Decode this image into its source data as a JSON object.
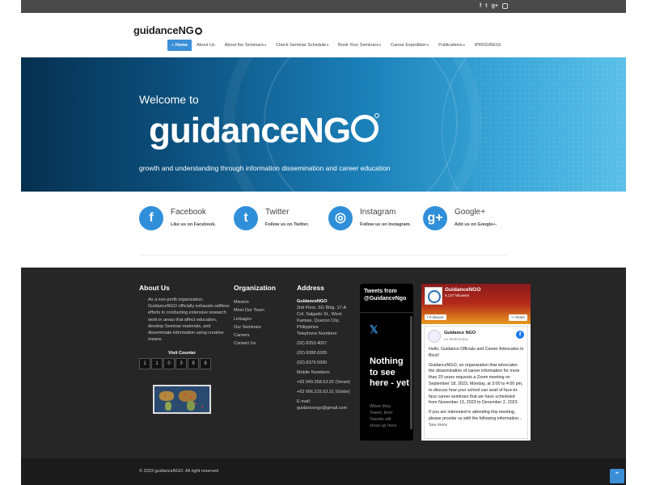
{
  "topbar": {
    "social_icons": [
      {
        "icon": "facebook-icon",
        "glyph": "f"
      },
      {
        "icon": "twitter-icon",
        "glyph": "t"
      },
      {
        "icon": "google-plus-icon",
        "glyph": "g+"
      },
      {
        "icon": "instagram-icon",
        "glyph": ""
      }
    ]
  },
  "logo": {
    "text": "guidanceNG"
  },
  "nav": {
    "home": "Home",
    "about": "About Us",
    "seminars": "About the Seminars",
    "schedule": "Check Seminar Schedule",
    "book": "Book Your Seminars",
    "expedition": "Career Expedition",
    "publications": "Publications",
    "iprogress": "IPROGRESS",
    "caret": "▾"
  },
  "hero": {
    "welcome": "Welcome to",
    "title": "guidanceNG",
    "tagline": "growth and understanding through information dissemination and career education"
  },
  "socials": {
    "facebook": {
      "glyph": "f",
      "name": "Facebook",
      "sub": "Like us on Facebook."
    },
    "twitter": {
      "glyph": "t",
      "name": "Twitter",
      "sub": "Follow us on Twitter."
    },
    "instagram": {
      "glyph": "◎",
      "name": "Instagram",
      "sub": "Follow us on Instagram."
    },
    "google": {
      "glyph": "g+",
      "name": "Google+",
      "sub": "Add us on Google+."
    }
  },
  "footer": {
    "about": {
      "heading": "About Us",
      "text": "As a non-profit organization, GuidanceNGO officially exhausts selfless efforts in conducting extensive research work in areas that affect education, develop Seminar materials, and disseminate information using creative means.",
      "visit_label": "Visit Counter",
      "counter_digits": [
        "1",
        "1",
        "0",
        "3",
        "9",
        "6"
      ]
    },
    "organization": {
      "heading": "Organization",
      "links": [
        "Mission",
        "Meet Our Team",
        "Linkages",
        "Our Seminars",
        "Careers",
        "Contact Us"
      ]
    },
    "address": {
      "heading": "Address",
      "org": "GuidanceNGO",
      "line1": "2nd Floor, SG Bldg. 17-A Col. Salgado St., West Kamias, Quezon City, Philippines",
      "tel_label": "Telephone Numbers:",
      "tel1": "(02) 8253.4057",
      "tel2": "(02) 8288.6265",
      "tel3": "(02) 8376.5990",
      "mobile_label": "Mobile Numbers:",
      "mobile1": "+63 949.358.53.92 (Smart)",
      "mobile2": "+63 906.315.63.31 (Globe)",
      "email_label": "E-mail:",
      "email": "guidancengo@gmail.com"
    },
    "twitter": {
      "heading": "Tweets from @GuidanceNgo",
      "empty_title": "Nothing to see here - yet",
      "empty_text": "When they Tweet, their Tweets will show up here."
    },
    "facebook": {
      "page_name": "GuidanceNGO",
      "followers": "6,137 followers",
      "followed": "Followed",
      "share": "Share",
      "post_author": "Guidance NGO",
      "post_when": "on Wednesday",
      "post_p1": "Hello, Guidance Officials and Career Advocates in Bicol!",
      "post_p2": "GuidanceNGO, an organization that advocates the dissemination of career information for more than 20 years requests a Zoom meeting on September 18, 2023, Monday, at 3:00 to 4:00 pm, to discuss how your school can avail of face-to-face career seminars that we have scheduled from November 13, 2023 to December 2, 2023.",
      "post_p3": "If you are interested in attending this meeting, please provide us with the following information...",
      "see_more": "See more"
    }
  },
  "bottom": {
    "copyright": "© 2023 guidanceNGO. All right reserved",
    "to_top": "⌃"
  },
  "colors": {
    "accent": "#3a8fd6",
    "footer_bg": "#262626",
    "bottom_bg": "#1b1b1b"
  }
}
